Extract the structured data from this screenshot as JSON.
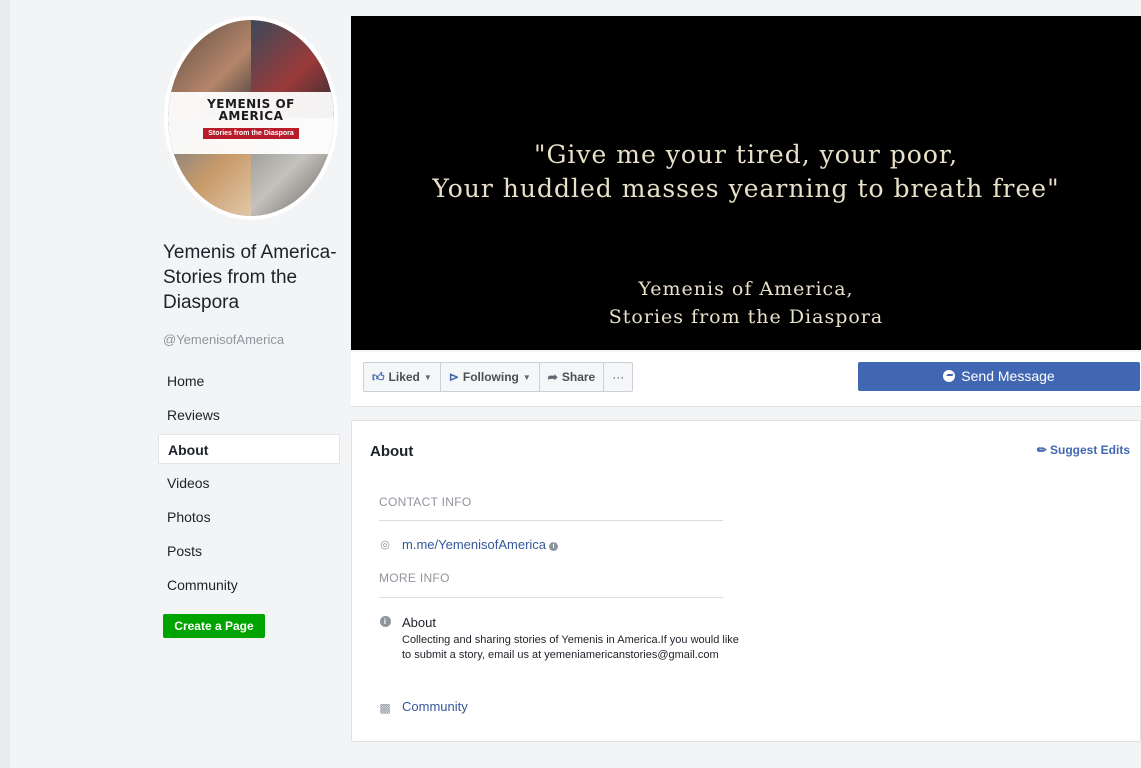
{
  "profile": {
    "logo_title_line1": "YEMENIS OF",
    "logo_title_line2": "AMERICA",
    "logo_subtitle": "Stories from the Diaspora"
  },
  "page": {
    "name": "Yemenis of America- Stories from the Diaspora",
    "handle": "@YemenisofAmerica"
  },
  "nav": {
    "items": [
      "Home",
      "Reviews",
      "About",
      "Videos",
      "Photos",
      "Posts",
      "Community"
    ],
    "active": "About"
  },
  "create_page_label": "Create a Page",
  "cover": {
    "quote_line1": "\"Give me your tired, your poor,",
    "quote_line2": "Your huddled masses yearning to breath free\"",
    "sub_line1": "Yemenis of America,",
    "sub_line2": "Stories from the Diaspora"
  },
  "actions": {
    "liked": "Liked",
    "following": "Following",
    "share": "Share",
    "more": "···",
    "send_message": "Send Message"
  },
  "about": {
    "title": "About",
    "suggest_edits": "Suggest Edits",
    "contact_header": "CONTACT INFO",
    "messenger_link": "m.me/YemenisofAmerica",
    "more_header": "MORE INFO",
    "about_label": "About",
    "about_text": "Collecting and sharing stories of Yemenis in America.If you would like to submit a story, email us at yemeniamericanstories@gmail.com",
    "category": "Community"
  },
  "colors": {
    "brand_blue": "#4267b2",
    "create_green": "#00a400",
    "link_blue": "#365899"
  }
}
